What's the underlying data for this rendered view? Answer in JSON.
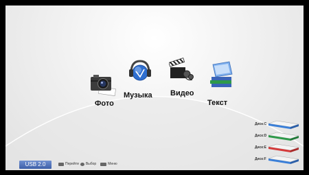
{
  "menu": [
    {
      "id": "photo",
      "label": "Фото",
      "icon": "camera-icon"
    },
    {
      "id": "music",
      "label": "Музыка",
      "icon": "headphones-icon"
    },
    {
      "id": "video",
      "label": "Видео",
      "icon": "clapperboard-icon"
    },
    {
      "id": "text",
      "label": "Текст",
      "icon": "books-icon"
    }
  ],
  "footer": {
    "usb_label": "USB 2.0",
    "hints": [
      {
        "icon": "arrows-icon",
        "label": "Перейти"
      },
      {
        "icon": "ok-icon",
        "label": "Выбор"
      },
      {
        "icon": "menu-key-icon",
        "label": "Меню"
      }
    ]
  },
  "disks": [
    {
      "label": "Диск:C",
      "color": "#3a7fd8"
    },
    {
      "label": "Диск:D",
      "color": "#2e9a4a"
    },
    {
      "label": "Диск:E",
      "color": "#d53a3a"
    },
    {
      "label": "Диск:F",
      "color": "#3a7fd8"
    }
  ],
  "colors": {
    "usb_badge": "#4e6fbd",
    "background": "#efefef"
  }
}
